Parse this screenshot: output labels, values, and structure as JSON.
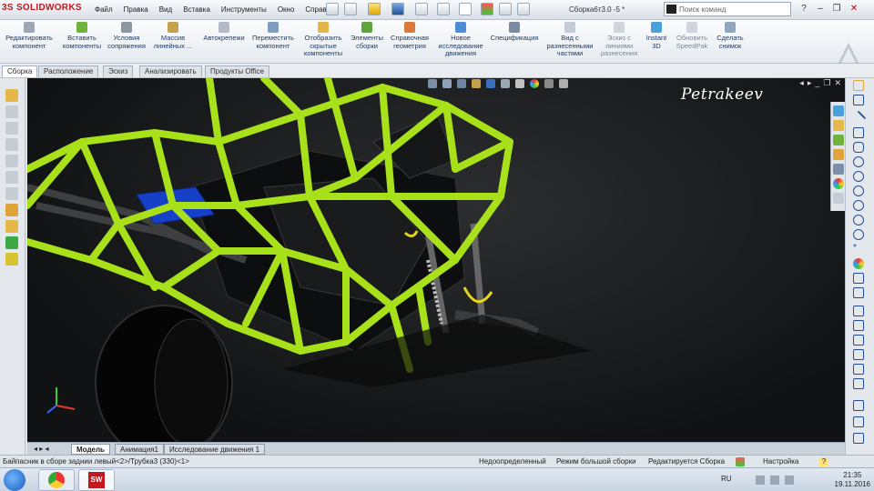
{
  "app": {
    "logo_text": "SOLIDWORKS",
    "logo_prefix": "3S"
  },
  "menu": [
    "Файл",
    "Правка",
    "Вид",
    "Вставка",
    "Инструменты",
    "Окно",
    "Справка"
  ],
  "title": "Сборка6т3.0 -5 *",
  "search": {
    "placeholder": "Поиск команд"
  },
  "ribbon": [
    {
      "label": "Редактировать компонент"
    },
    {
      "label": "Вставить компоненты"
    },
    {
      "label": "Условия сопряжения"
    },
    {
      "label": "Массив линейных ..."
    },
    {
      "label": "Автокрепежи"
    },
    {
      "label": "Переместить компонент"
    },
    {
      "label": "Отобразить скрытые компоненты"
    },
    {
      "label": "Элементы сборки"
    },
    {
      "label": "Справочная геометрия"
    },
    {
      "label": "Новое исследование движения"
    },
    {
      "label": "Спецификация"
    },
    {
      "label": "Вид с разнесенными частями"
    },
    {
      "label": "Эскиз с линиями разнесения"
    },
    {
      "label": "Instant 3D"
    },
    {
      "label": "Обновить SpeedPak"
    },
    {
      "label": "Сделать снимок"
    }
  ],
  "tabs": [
    "Сборка",
    "Расположение",
    "Эскиз",
    "Анализировать",
    "Продукты Office"
  ],
  "viewport": {
    "watermark": "Petrakeev"
  },
  "bottom_tabs": [
    "Модель",
    "Анимация1",
    "Исследование движения 1"
  ],
  "status": {
    "left": "Байпасник в сборе заднии левый<2>/Трубка3 (330)<1>",
    "underdefined": "Недоопределенный",
    "large_assembly": "Режим большой сборки",
    "editing": "Редактируется Сборка",
    "settings": "Настройка",
    "help": "?"
  },
  "taskbar": {
    "lang": "RU",
    "time": "21:35",
    "date": "19.11.2016"
  },
  "colors": {
    "frame": "#a8e01a",
    "accent": "#1f4e9c"
  }
}
